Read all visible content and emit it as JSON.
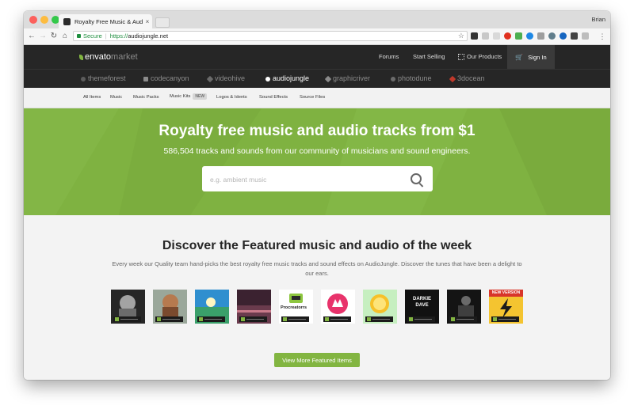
{
  "browser": {
    "tab_title": "Royalty Free Music & Audio Tr",
    "profile_name": "Brian",
    "url_secure_label": "Secure",
    "url_scheme": "https://",
    "url_host": "audiojungle.net"
  },
  "topnav": {
    "logo_main": "envato",
    "logo_suffix": "market",
    "links": [
      "Forums",
      "Start Selling",
      "Our Products"
    ],
    "signin": "Sign In"
  },
  "sites": [
    "themeforest",
    "codecanyon",
    "videohive",
    "audiojungle",
    "graphicriver",
    "photodune",
    "3docean"
  ],
  "categories": [
    "All Items",
    "Music",
    "Music Packs",
    "Music Kits",
    "Logos & Idents",
    "Sound Effects",
    "Source Files"
  ],
  "new_badge": "NEW",
  "hero": {
    "title": "Royalty free music and audio tracks from $1",
    "subtitle": "586,504 tracks and sounds from our community of musicians and sound engineers.",
    "search_placeholder": "e.g. ambient music"
  },
  "featured": {
    "title": "Discover the Featured music and audio of the week",
    "description": "Every week our Quality team hand-picks the best royalty free music tracks and sound effects on AudioJungle. Discover the tunes that have been a delight to our ears.",
    "button": "View More Featured Items",
    "thumbs": [
      {
        "icon": "man-with-headphones-artwork",
        "text": ""
      },
      {
        "icon": "bearded-man-artwork",
        "text": ""
      },
      {
        "icon": "landscape-artwork",
        "text": ""
      },
      {
        "icon": "dark-sunset-artwork",
        "text": ""
      },
      {
        "icon": "cassette-artwork",
        "text": "Procreatorrs"
      },
      {
        "icon": "pink-logo-artwork",
        "text": ""
      },
      {
        "icon": "lemon-slice-artwork",
        "text": ""
      },
      {
        "icon": "black-text-artwork",
        "text": "DARKIE DAVE"
      },
      {
        "icon": "dj-performer-artwork",
        "text": ""
      },
      {
        "icon": "lightning-bolt-artwork",
        "text": "NEW VERSION"
      }
    ]
  },
  "colors": {
    "accent_green": "#82b541",
    "hero_green": "#7fb241",
    "nav_dark": "#262626"
  }
}
